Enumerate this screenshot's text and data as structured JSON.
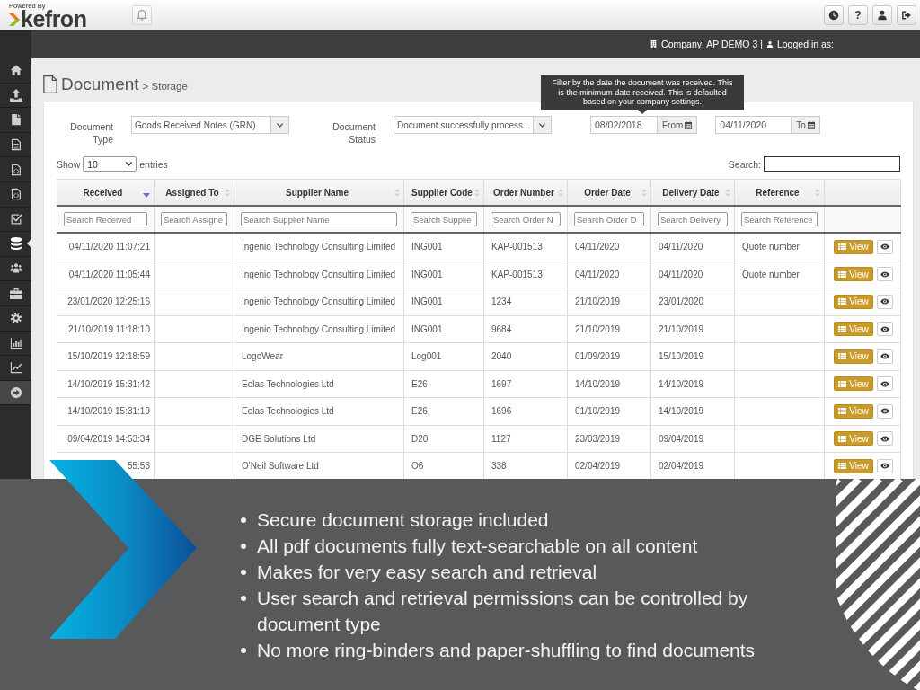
{
  "header": {
    "powered_by": "Powered By",
    "logo": "kefron",
    "help_button": "?"
  },
  "top_bar": {
    "company": "Company: AP DEMO 3 |",
    "user": "Logged in as:"
  },
  "sidebar": {
    "items": [
      {
        "kind": "link",
        "selected": false
      },
      {
        "kind": "link",
        "selected": false
      },
      {
        "kind": "link",
        "selected": false
      },
      {
        "kind": "link",
        "selected": false
      },
      {
        "kind": "link",
        "selected": false
      },
      {
        "kind": "link",
        "selected": false
      },
      {
        "kind": "link",
        "selected": false
      },
      {
        "kind": "link",
        "selected": true
      },
      {
        "kind": "link",
        "selected": false
      },
      {
        "kind": "link",
        "selected": false
      },
      {
        "kind": "link",
        "selected": false
      },
      {
        "kind": "link",
        "selected": false
      },
      {
        "kind": "link",
        "selected": false
      },
      {
        "kind": "toggle",
        "selected": false
      }
    ]
  },
  "page": {
    "title": "Document",
    "breadcrumb": "> Storage"
  },
  "filters": {
    "document_type": {
      "label": "Document Type",
      "value": "Goods Received Notes (GRN)"
    },
    "document_status": {
      "label": "Document Status",
      "value": "Document successfully process..."
    },
    "date_from": {
      "value": "08/02/2018",
      "addon": "From"
    },
    "date_to": {
      "value": "04/11/2020",
      "addon": "To"
    }
  },
  "tooltip": {
    "text": "Filter by the date the document was received. This is the minimum date received. This is defaulted based on your company settings."
  },
  "table_controls": {
    "show_label": "Show",
    "page_size": "10",
    "entries_label": "entries",
    "search_label": "Search:"
  },
  "table": {
    "columns": [
      {
        "label": "Received",
        "sorted": true,
        "filter_placeholder": "Search Received"
      },
      {
        "label": "Assigned To",
        "sorted": false,
        "filter_placeholder": "Search Assigne"
      },
      {
        "label": "Supplier Name",
        "sorted": false,
        "filter_placeholder": "Search Supplier Name"
      },
      {
        "label": "Supplier Code",
        "sorted": false,
        "filter_placeholder": "Search Supplie"
      },
      {
        "label": "Order Number",
        "sorted": false,
        "filter_placeholder": "Search Order N"
      },
      {
        "label": "Order Date",
        "sorted": false,
        "filter_placeholder": "Search Order D"
      },
      {
        "label": "Delivery Date",
        "sorted": false,
        "filter_placeholder": "Search Delivery"
      },
      {
        "label": "Reference",
        "sorted": false,
        "filter_placeholder": "Search Reference"
      }
    ],
    "rows": [
      {
        "received": "04/11/2020 11:07:21",
        "supplier_name": "Ingenio Technology Consulting Limited",
        "supplier_code": "ING001",
        "order_number": "KAP-001513",
        "order_date": "04/11/2020",
        "delivery_date": "04/11/2020",
        "reference": "Quote number",
        "view_button": "View"
      },
      {
        "received": "04/11/2020 11:05:44",
        "supplier_name": "Ingenio Technology Consulting Limited",
        "supplier_code": "ING001",
        "order_number": "KAP-001513",
        "order_date": "04/11/2020",
        "delivery_date": "04/11/2020",
        "reference": "Quote number",
        "view_button": "View"
      },
      {
        "received": "23/01/2020 12:25:16",
        "supplier_name": "Ingenio Technology Consulting Limited",
        "supplier_code": "ING001",
        "order_number": "1234",
        "order_date": "21/10/2019",
        "delivery_date": "23/01/2020",
        "view_button": "View"
      },
      {
        "received": "21/10/2019 11:18:10",
        "supplier_name": "Ingenio Technology Consulting Limited",
        "supplier_code": "ING001",
        "order_number": "9684",
        "order_date": "21/10/2019",
        "delivery_date": "21/10/2019",
        "view_button": "View"
      },
      {
        "received": "15/10/2019 12:18:59",
        "supplier_name": "LogoWear",
        "supplier_code": "Log001",
        "order_number": "2040",
        "order_date": "01/09/2019",
        "delivery_date": "15/10/2019",
        "view_button": "View"
      },
      {
        "received": "14/10/2019 15:31:42",
        "supplier_name": "Eolas Technologies Ltd",
        "supplier_code": "E26",
        "order_number": "1697",
        "order_date": "14/10/2019",
        "delivery_date": "14/10/2019",
        "view_button": "View"
      },
      {
        "received": "14/10/2019 15:31:19",
        "supplier_name": "Eolas Technologies Ltd",
        "supplier_code": "E26",
        "order_number": "1696",
        "order_date": "01/10/2019",
        "delivery_date": "14/10/2019",
        "view_button": "View"
      },
      {
        "received": "09/04/2019 14:53:34",
        "supplier_name": "DGE Solutions Ltd",
        "supplier_code": "D20",
        "order_number": "1127",
        "order_date": "23/03/2019",
        "delivery_date": "09/04/2019",
        "view_button": "View"
      },
      {
        "received": "55:53",
        "supplier_name": "O'Neil Software Ltd",
        "supplier_code": "O6",
        "order_number": "338",
        "order_date": "02/04/2019",
        "delivery_date": "02/04/2019",
        "view_button": "View"
      }
    ]
  },
  "banner": {
    "bullets": [
      "Secure document storage included",
      "All pdf documents fully text-searchable on all content",
      "Makes for very easy search and retrieval",
      "User search and retrieval permissions can be controlled by document type",
      "No more ring-binders and paper-shuffling to find documents"
    ]
  }
}
